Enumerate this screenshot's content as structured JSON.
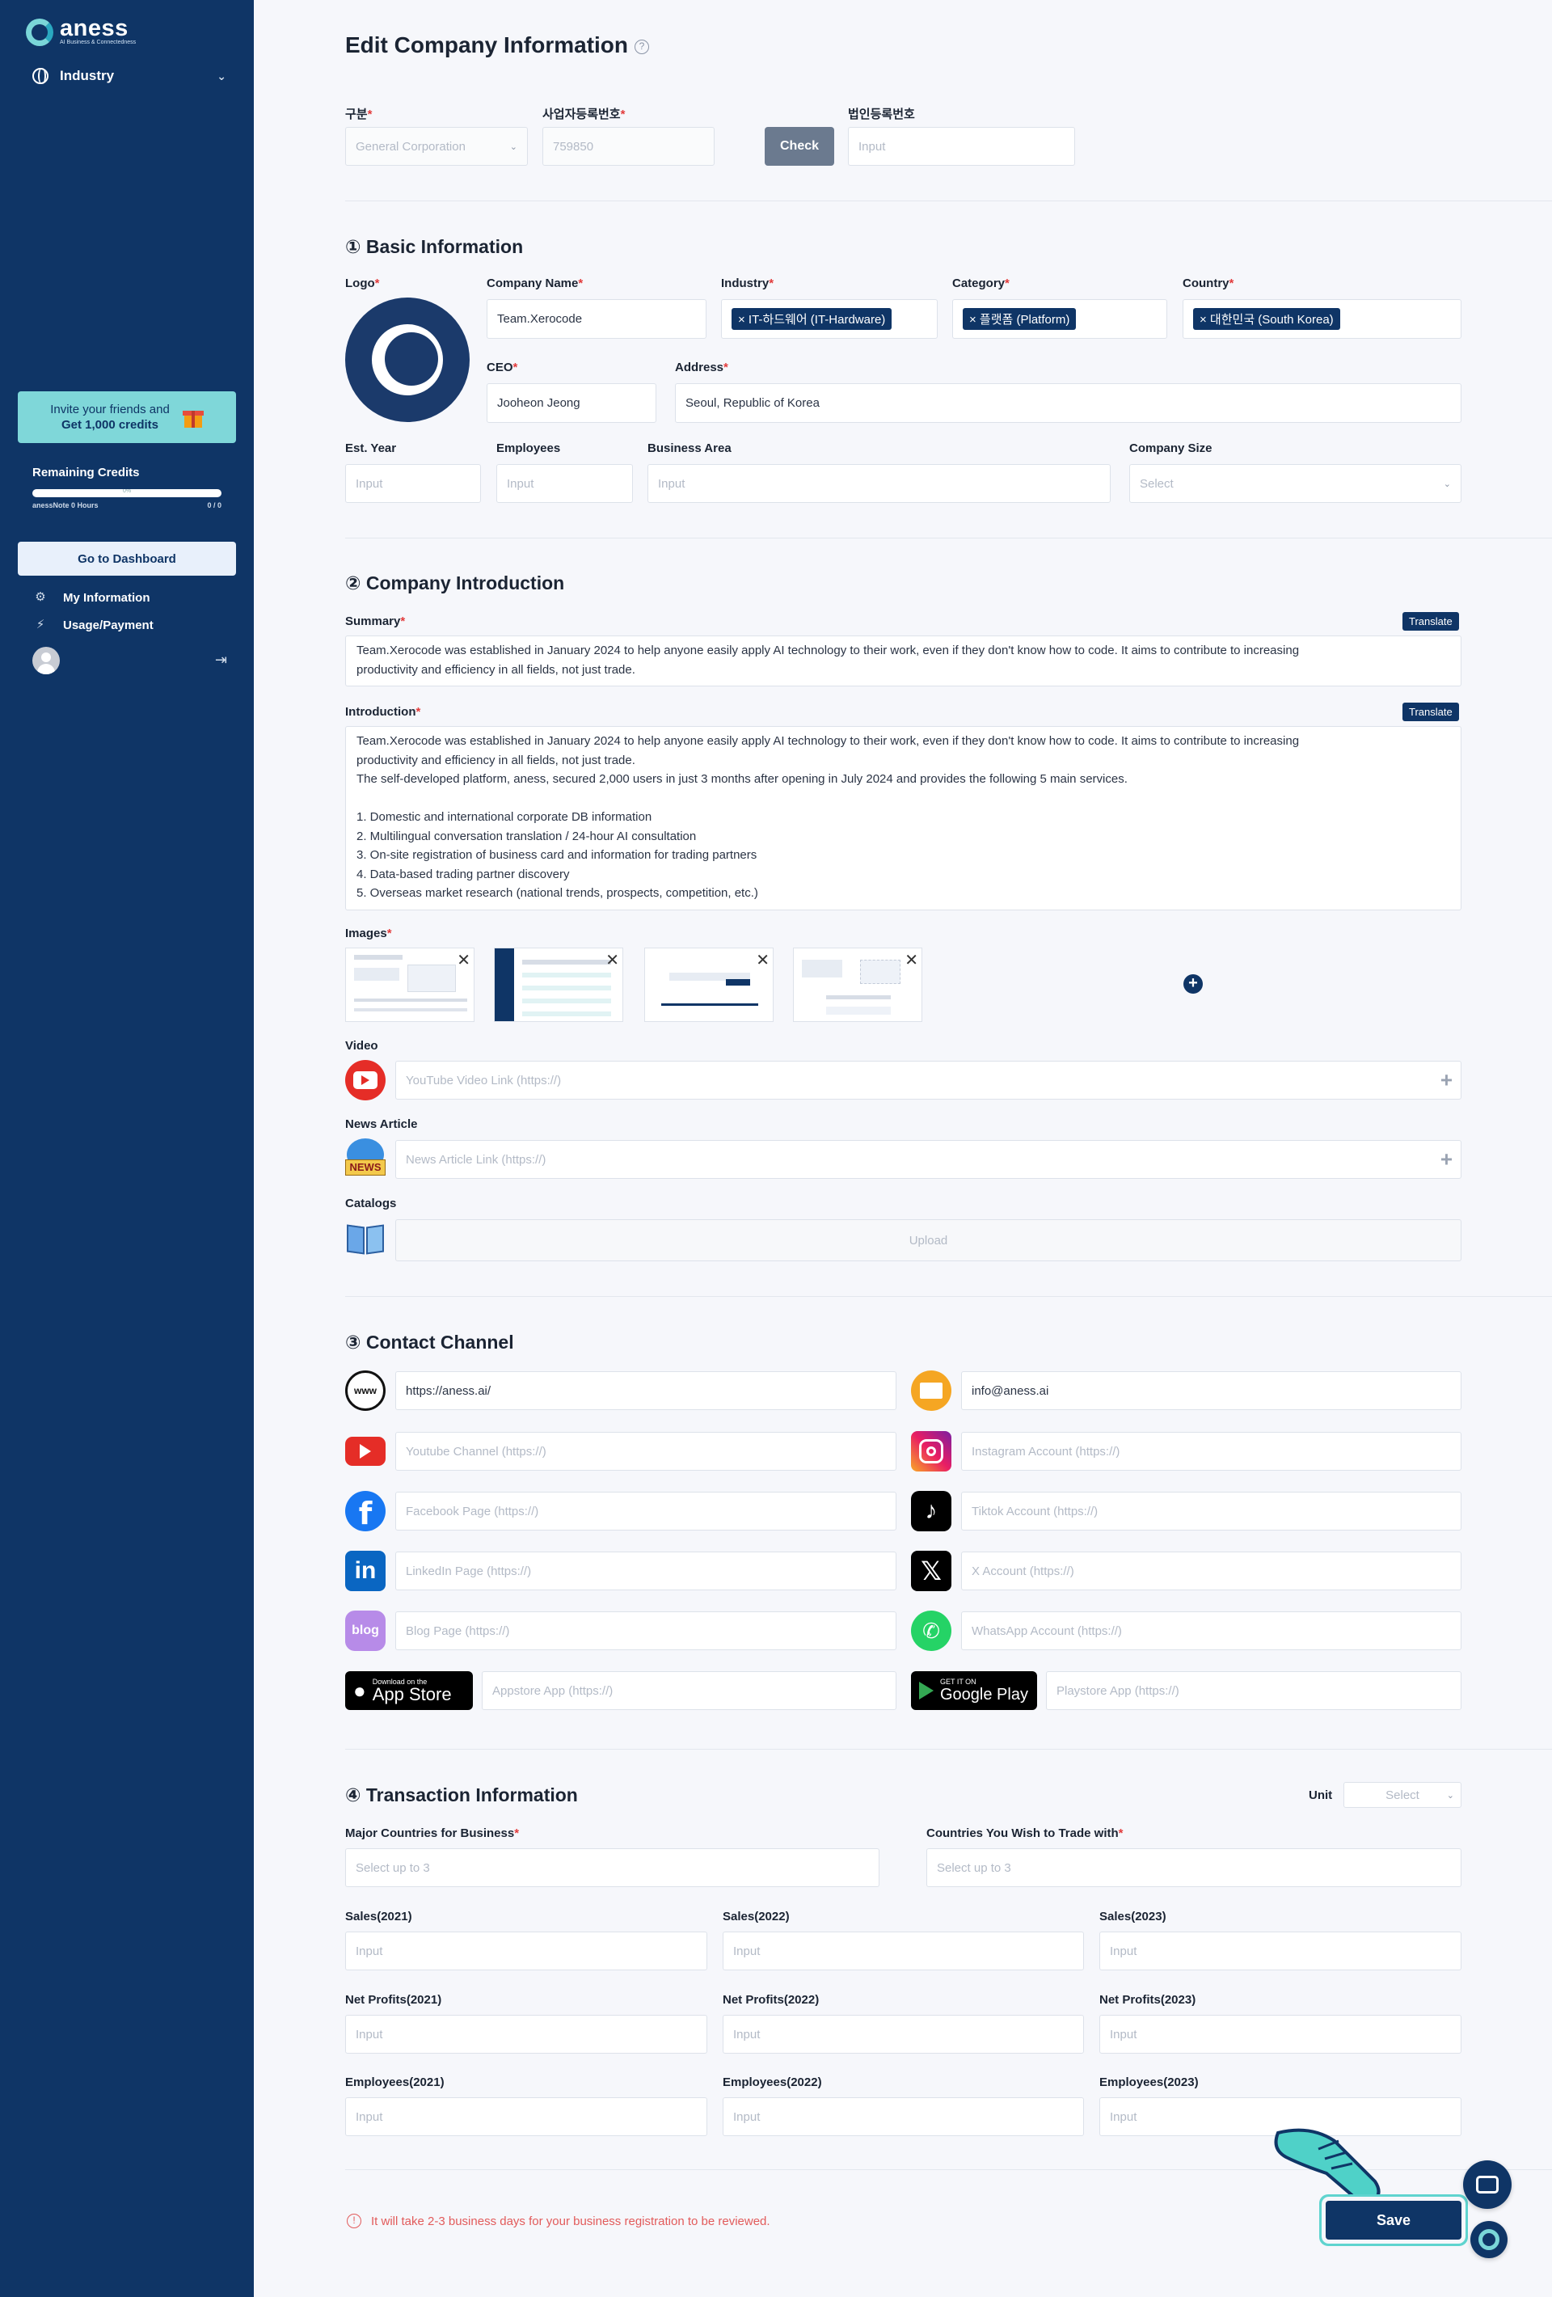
{
  "sidebar": {
    "logo_name": "aness",
    "logo_tagline": "AI Business & Connectedness",
    "nav_industry": "Industry",
    "invite_line1": "Invite your friends and",
    "invite_line2": "Get 1,000 credits",
    "credits_title": "Remaining Credits",
    "credits_percent": "0%",
    "credits_progress": 0,
    "credits_note": "anessNote 0 Hours",
    "credits_count": "0 / 0",
    "dashboard_button": "Go to Dashboard",
    "my_information": "My Information",
    "usage_payment": "Usage/Payment"
  },
  "page": {
    "title": "Edit Company Information"
  },
  "registration": {
    "type_label": "구분",
    "type_value": "General Corporation",
    "biz_no_label": "사업자등록번호",
    "biz_no_value": "759850",
    "check_button": "Check",
    "corp_no_label": "법인등록번호",
    "corp_no_placeholder": "Input"
  },
  "basic": {
    "title": "① Basic Information",
    "logo_label": "Logo",
    "company_name_label": "Company Name",
    "company_name_value": "Team.Xerocode",
    "industry_label": "Industry",
    "industry_tag": "× IT-하드웨어 (IT-Hardware)",
    "category_label": "Category",
    "category_tag": "× 플랫폼 (Platform)",
    "country_label": "Country",
    "country_tag": "× 대한민국 (South Korea)",
    "ceo_label": "CEO",
    "ceo_value": "Jooheon Jeong",
    "address_label": "Address",
    "address_value": "Seoul, Republic of Korea",
    "est_year_label": "Est. Year",
    "est_year_placeholder": "Input",
    "employees_label": "Employees",
    "employees_placeholder": "Input",
    "business_area_label": "Business Area",
    "business_area_placeholder": "Input",
    "company_size_label": "Company Size",
    "company_size_placeholder": "Select"
  },
  "intro": {
    "title": "② Company Introduction",
    "translate": "Translate",
    "summary_label": "Summary",
    "summary_line1": "Team.Xerocode was established in January 2024 to help anyone easily apply AI technology to their work, even if they don't know how to code. It aims to contribute to increasing",
    "summary_line2": "productivity and efficiency in all fields, not just trade.",
    "introduction_label": "Introduction",
    "introduction_lines": [
      "Team.Xerocode was established in January 2024 to help anyone easily apply AI technology to their work, even if they don't know how to code. It aims to contribute to increasing",
      "productivity and efficiency in all fields, not just trade.",
      "The self-developed platform, aness, secured 2,000 users in just 3 months after opening in July 2024 and provides the following 5 main services.",
      "",
      "1. Domestic and international corporate DB information",
      "2. Multilingual conversation translation / 24-hour AI consultation",
      "3. On-site registration of business card and information for trading partners",
      "4. Data-based trading partner discovery",
      "5. Overseas market research (national trends, prospects, competition, etc.)"
    ],
    "images_label": "Images",
    "video_label": "Video",
    "video_placeholder": "YouTube Video Link (https://)",
    "news_label": "News Article",
    "news_placeholder": "News Article Link (https://)",
    "news_badge": "NEWS",
    "catalogs_label": "Catalogs",
    "upload": "Upload"
  },
  "contact": {
    "title": "③ Contact Channel",
    "website_value": "https://aness.ai/",
    "email_value": "info@aness.ai",
    "youtube_placeholder": "Youtube Channel (https://)",
    "instagram_placeholder": "Instagram Account (https://)",
    "facebook_placeholder": "Facebook Page (https://)",
    "tiktok_placeholder": "Tiktok Account (https://)",
    "linkedin_placeholder": "LinkedIn Page (https://)",
    "x_placeholder": "X Account (https://)",
    "blog_placeholder": "Blog Page (https://)",
    "blog_badge": "blog",
    "whatsapp_placeholder": "WhatsApp Account (https://)",
    "appstore_small": "Download on the",
    "appstore_big": "App Store",
    "appstore_placeholder": "Appstore App (https://)",
    "googleplay_small": "GET IT ON",
    "googleplay_big": "Google Play",
    "playstore_placeholder": "Playstore App (https://)"
  },
  "transaction": {
    "title": "④ Transaction Information",
    "unit_label": "Unit",
    "unit_placeholder": "Select",
    "major_countries_label": "Major Countries for Business",
    "wish_countries_label": "Countries You Wish to Trade with",
    "select_up_to": "Select up to 3",
    "input": "Input",
    "sales_2021": "Sales(2021)",
    "sales_2022": "Sales(2022)",
    "sales_2023": "Sales(2023)",
    "np_2021": "Net Profits(2021)",
    "np_2022": "Net Profits(2022)",
    "np_2023": "Net Profits(2023)",
    "emp_2021": "Employees(2021)",
    "emp_2022": "Employees(2022)",
    "emp_2023": "Employees(2023)"
  },
  "footer": {
    "notice": "It will take 2-3 business days for your business registration to be reviewed.",
    "save": "Save"
  },
  "colors": {
    "navy": "#0f3566",
    "teal": "#7fd7d9",
    "required": "#e23b3b"
  }
}
